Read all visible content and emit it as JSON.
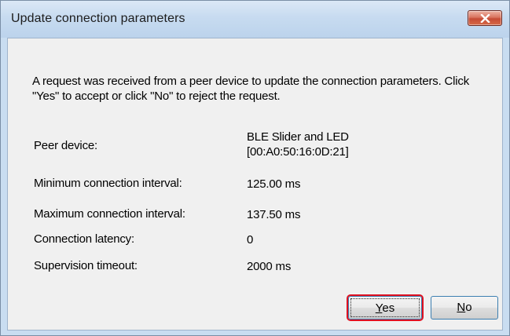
{
  "window": {
    "title": "Update connection parameters"
  },
  "message": "A request was received from a peer device to update the connection parameters. Click \"Yes\" to accept or click \"No\" to reject the request.",
  "fields": {
    "peer_device": {
      "label": "Peer device:",
      "value_line1": "BLE Slider and LED",
      "value_line2": "[00:A0:50:16:0D:21]"
    },
    "min_interval": {
      "label": "Minimum connection interval:",
      "value": "125.00 ms"
    },
    "max_interval": {
      "label": "Maximum connection interval:",
      "value": "137.50 ms"
    },
    "latency": {
      "label": "Connection latency:",
      "value": "0"
    },
    "timeout": {
      "label": "Supervision timeout:",
      "value": "2000 ms"
    }
  },
  "buttons": {
    "yes_mnemonic": "Y",
    "yes_rest": "es",
    "no_mnemonic": "N",
    "no_rest": "o"
  },
  "icons": {
    "close": "close-icon"
  },
  "colors": {
    "highlight_border": "#e01020",
    "close_button": "#c64b35"
  }
}
